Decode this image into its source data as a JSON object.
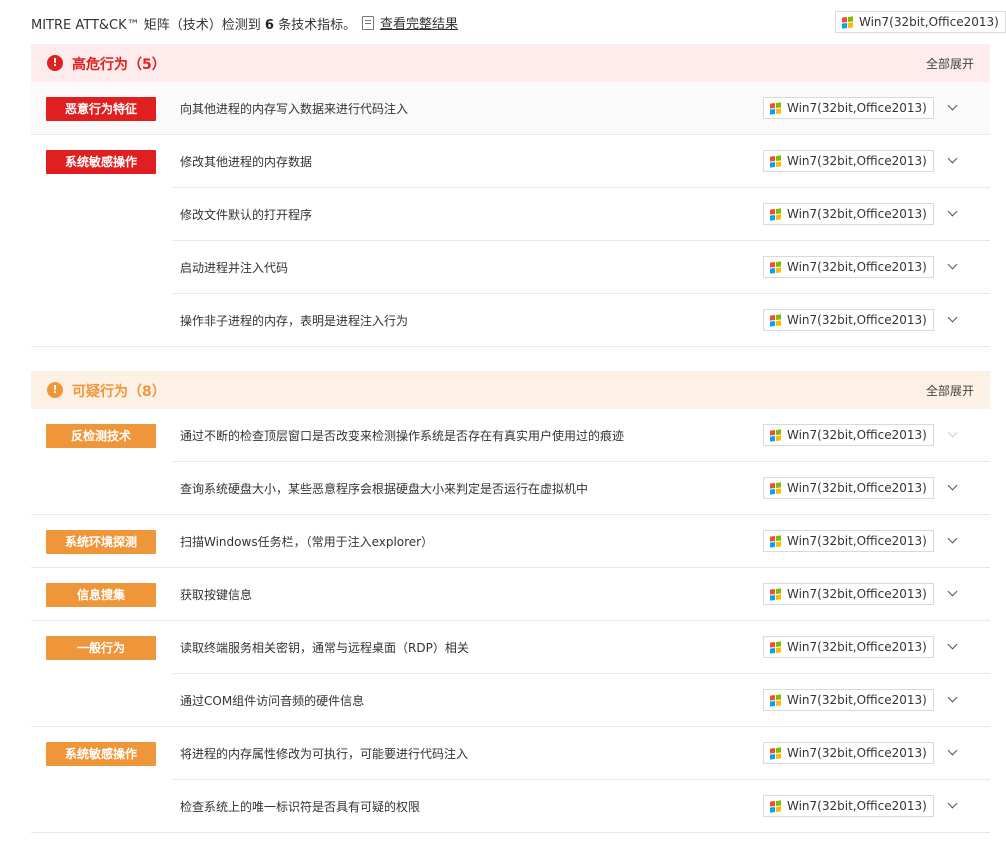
{
  "top": {
    "summary_prefix": "MITRE ATT&CK™ 矩阵（技术）检测到",
    "summary_count": "6",
    "summary_suffix": "条技术指标。",
    "view_full_label": "查看完整结果",
    "env": "Win7(32bit,Office2013)"
  },
  "colors": {
    "high": "#e02020",
    "high_bg": "#fdeceb",
    "sus": "#f0963a",
    "sus_bg": "#fdf1e5"
  },
  "sections": [
    {
      "title": "高危行为（5）",
      "expand_label": "全部展开",
      "rows": [
        {
          "category": "恶意行为特征",
          "description": "向其他进程的内存写入数据来进行代码注入",
          "env": "Win7(32bit,Office2013)"
        },
        {
          "category": "系统敏感操作",
          "description": "修改其他进程的内存数据",
          "env": "Win7(32bit,Office2013)"
        },
        {
          "category": "",
          "description": "修改文件默认的打开程序",
          "env": "Win7(32bit,Office2013)"
        },
        {
          "category": "",
          "description": "启动进程并注入代码",
          "env": "Win7(32bit,Office2013)"
        },
        {
          "category": "",
          "description": "操作非子进程的内存，表明是进程注入行为",
          "env": "Win7(32bit,Office2013)"
        }
      ]
    },
    {
      "title": "可疑行为（8）",
      "expand_label": "全部展开",
      "rows": [
        {
          "category": "反检测技术",
          "description": "通过不断的检查顶层窗口是否改变来检测操作系统是否存在有真实用户使用过的痕迹",
          "env": "Win7(32bit,Office2013)"
        },
        {
          "category": "",
          "description": "查询系统硬盘大小，某些恶意程序会根据硬盘大小来判定是否运行在虚拟机中",
          "env": "Win7(32bit,Office2013)"
        },
        {
          "category": "系统环境探测",
          "description": "扫描Windows任务栏，（常用于注入explorer）",
          "env": "Win7(32bit,Office2013)"
        },
        {
          "category": "信息搜集",
          "description": "获取按键信息",
          "env": "Win7(32bit,Office2013)"
        },
        {
          "category": "一般行为",
          "description": "读取终端服务相关密钥，通常与远程桌面（RDP）相关",
          "env": "Win7(32bit,Office2013)"
        },
        {
          "category": "",
          "description": "通过COM组件访问音频的硬件信息",
          "env": "Win7(32bit,Office2013)"
        },
        {
          "category": "系统敏感操作",
          "description": "将进程的内存属性修改为可执行，可能要进行代码注入",
          "env": "Win7(32bit,Office2013)"
        },
        {
          "category": "",
          "description": "检查系统上的唯一标识符是否具有可疑的权限",
          "env": "Win7(32bit,Office2013)"
        }
      ]
    }
  ]
}
